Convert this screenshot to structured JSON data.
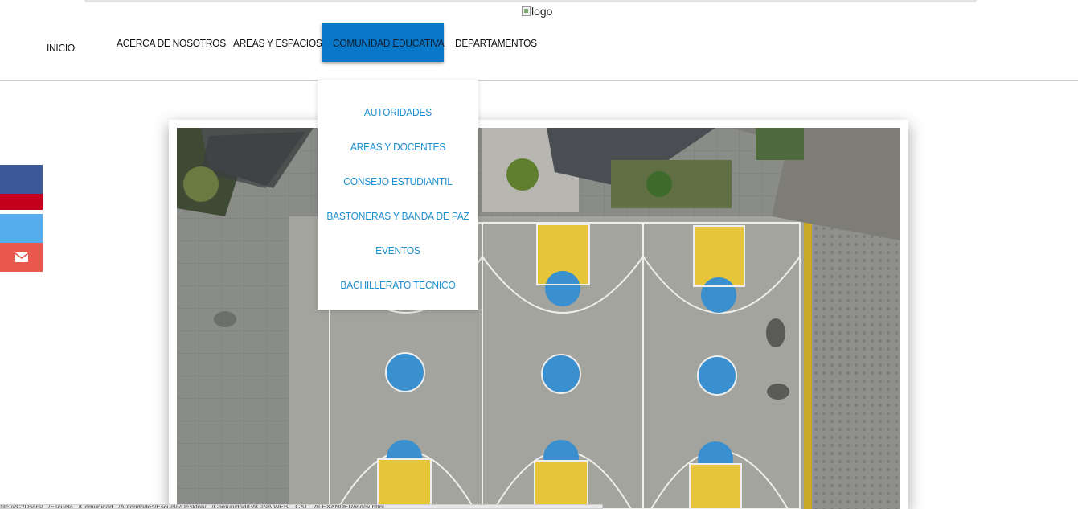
{
  "logo": {
    "alt": "logo"
  },
  "nav": {
    "items": [
      "INICIO",
      "ACERCA DE NOSOTROS",
      "AREAS Y ESPACIOS",
      "COMUNIDAD EDUCATIVA",
      "DEPARTAMENTOS"
    ],
    "active": "COMUNIDAD EDUCATIVA"
  },
  "dropdown": {
    "items": [
      "AUTORIDADES",
      "AREAS Y DOCENTES",
      "CONSEJO ESTUDIANTIL",
      "BASTONERAS Y BANDA DE PAZ",
      "EVENTOS",
      "BACHILLERATO TECNICO"
    ]
  },
  "social": {
    "buttons": [
      "facebook-share",
      "google-share",
      "twitter-share",
      "email-share"
    ]
  },
  "colors": {
    "accent": "#0a78c8",
    "dropdown_text": "#1d8fd0",
    "facebook": "#3b5998",
    "google": "#c4001a",
    "twitter": "#55acee",
    "email": "#e8584c"
  },
  "status_bar": {
    "text": "file:///C:/Users/.../Escuela.../Comunidad.../Autoridades/Escuela/Desktop/.../Comunidad/PAGINA WEB/...GAT... ALEXANDER/index.html"
  }
}
